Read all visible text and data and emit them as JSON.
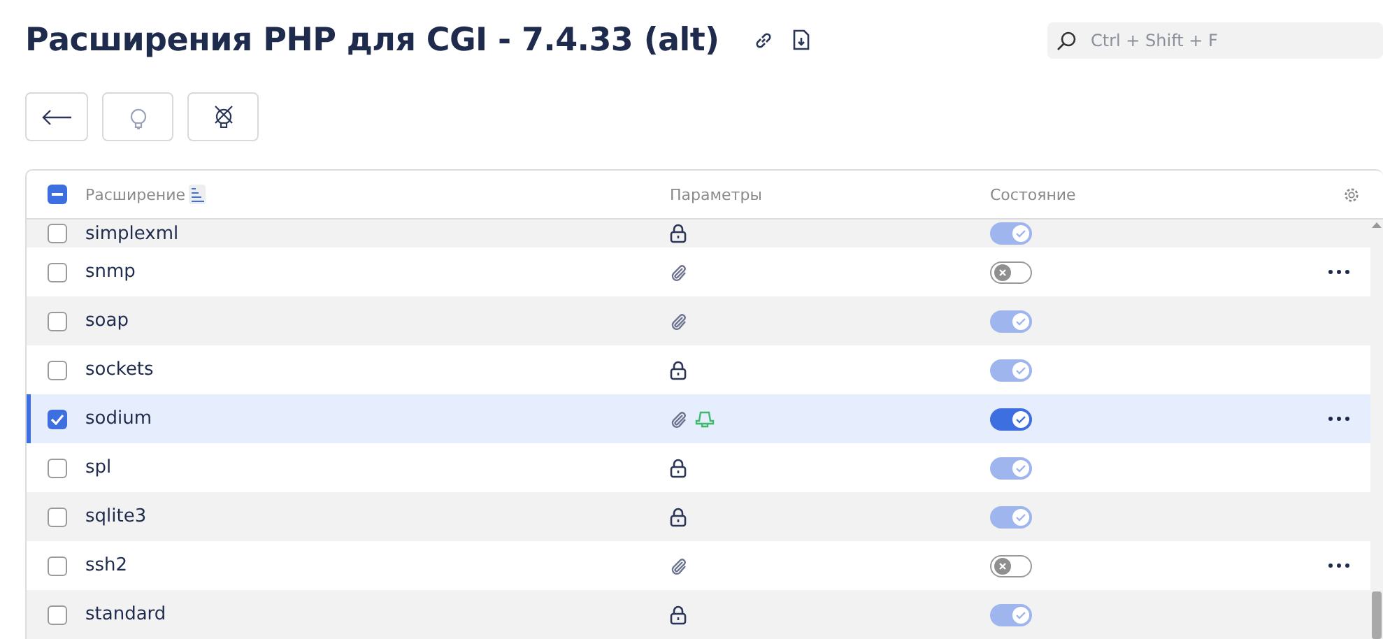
{
  "title": "Расширения PHP для CGI - 7.4.33 (alt)",
  "search": {
    "placeholder": "Ctrl + Shift + F"
  },
  "table": {
    "select_all_indeterminate": true,
    "columns": [
      "Расширение",
      "Параметры",
      "Состояние"
    ],
    "rows": [
      {
        "name": "simplexml",
        "checked": false,
        "selected": false,
        "params": [
          {
            "kind": "lock"
          }
        ],
        "on": true,
        "locked": true,
        "menu": false
      },
      {
        "name": "snmp",
        "checked": false,
        "selected": false,
        "params": [
          {
            "kind": "clip"
          }
        ],
        "on": false,
        "menu": true
      },
      {
        "name": "soap",
        "checked": false,
        "selected": false,
        "params": [
          {
            "kind": "clip"
          }
        ],
        "on": true,
        "locked": true,
        "menu": false
      },
      {
        "name": "sockets",
        "checked": false,
        "selected": false,
        "params": [
          {
            "kind": "lock"
          }
        ],
        "on": true,
        "locked": true,
        "menu": false
      },
      {
        "name": "sodium",
        "checked": true,
        "selected": true,
        "params": [
          {
            "kind": "clip"
          },
          {
            "kind": "bell"
          }
        ],
        "on": true,
        "locked": false,
        "menu": true
      },
      {
        "name": "spl",
        "checked": false,
        "selected": false,
        "params": [
          {
            "kind": "lock"
          }
        ],
        "on": true,
        "locked": true,
        "menu": false
      },
      {
        "name": "sqlite3",
        "checked": false,
        "selected": false,
        "params": [
          {
            "kind": "lock"
          }
        ],
        "on": true,
        "locked": true,
        "menu": false
      },
      {
        "name": "ssh2",
        "checked": false,
        "selected": false,
        "params": [
          {
            "kind": "clip"
          }
        ],
        "on": false,
        "menu": true
      },
      {
        "name": "standard",
        "checked": false,
        "selected": false,
        "params": [
          {
            "kind": "lock"
          }
        ],
        "on": true,
        "locked": true,
        "menu": false
      }
    ]
  }
}
